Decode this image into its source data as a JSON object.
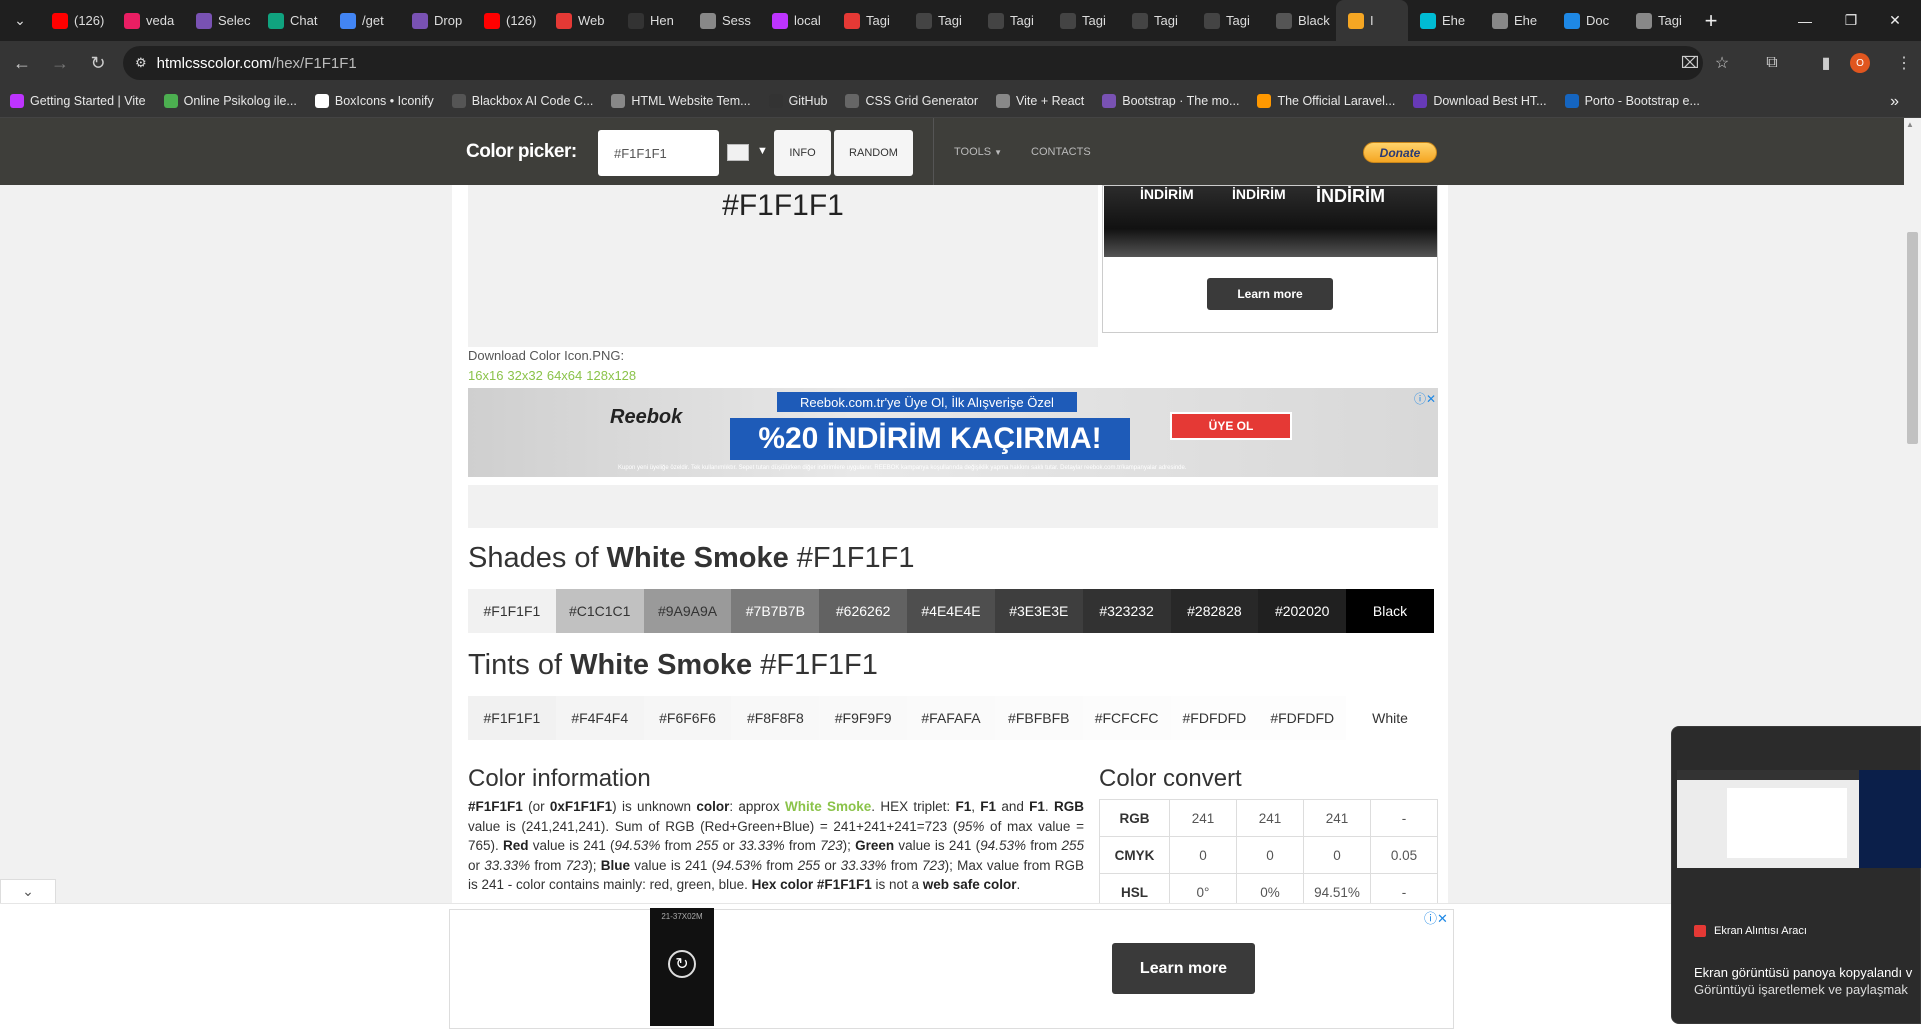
{
  "browser": {
    "tabs": [
      {
        "label": "(126)",
        "icon": "youtube-icon",
        "color": "#ff0000"
      },
      {
        "label": "veda",
        "icon": "bi-icon",
        "color": "#e91e63"
      },
      {
        "label": "Selec",
        "icon": "bootstrap-icon",
        "color": "#7952b3"
      },
      {
        "label": "Chat",
        "icon": "chatgpt-icon",
        "color": "#10a37f"
      },
      {
        "label": "/get",
        "icon": "google-icon",
        "color": "#4285f4"
      },
      {
        "label": "Drop",
        "icon": "bootstrap-icon",
        "color": "#7952b3"
      },
      {
        "label": "(126)",
        "icon": "youtube-icon",
        "color": "#ff0000"
      },
      {
        "label": "Web",
        "icon": "opera-icon",
        "color": "#e53935"
      },
      {
        "label": "Hen",
        "icon": "github-icon",
        "color": "#333333"
      },
      {
        "label": "Sess",
        "icon": "globe-icon",
        "color": "#888888"
      },
      {
        "label": "local",
        "icon": "vite-icon",
        "color": "#bd34fe"
      },
      {
        "label": "Tagi",
        "icon": "pencil-icon",
        "color": "#e53935"
      },
      {
        "label": "Tagi",
        "icon": "codepen-icon",
        "color": "#444444"
      },
      {
        "label": "Tagi",
        "icon": "codepen-icon",
        "color": "#444444"
      },
      {
        "label": "Tagi",
        "icon": "codepen-icon",
        "color": "#444444"
      },
      {
        "label": "Tagi",
        "icon": "codepen-icon",
        "color": "#444444"
      },
      {
        "label": "Tagi",
        "icon": "codepen-icon",
        "color": "#444444"
      },
      {
        "label": "Black",
        "icon": "blackbox-icon",
        "color": "#555555"
      },
      {
        "label": "I",
        "icon": "colorwheel-icon",
        "color": "#f5a623",
        "active": true
      },
      {
        "label": "Ehe",
        "icon": "e-icon",
        "color": "#00bcd4"
      },
      {
        "label": "Ehe",
        "icon": "globe-icon",
        "color": "#888888"
      },
      {
        "label": "Doc",
        "icon": "d-icon",
        "color": "#1e88e5"
      },
      {
        "label": "Tagi",
        "icon": "globe-icon",
        "color": "#888888"
      }
    ],
    "url_host": "htmlcsscolor.com",
    "url_path": "/hex/F1F1F1",
    "profile_initial": "O",
    "bookmarks": [
      {
        "label": "Getting Started | Vite",
        "icon": "vite-icon",
        "color": "#bd34fe"
      },
      {
        "label": "Online Psikolog ile...",
        "icon": "leaf-icon",
        "color": "#4caf50"
      },
      {
        "label": "BoxIcons • Iconify",
        "icon": "iconify-icon",
        "color": "#ffffff"
      },
      {
        "label": "Blackbox AI Code C...",
        "icon": "blackbox-icon",
        "color": "#555555"
      },
      {
        "label": "HTML Website Tem...",
        "icon": "globe-icon",
        "color": "#888888"
      },
      {
        "label": "GitHub",
        "icon": "github-icon",
        "color": "#333333"
      },
      {
        "label": "CSS Grid Generator",
        "icon": "grid-icon",
        "color": "#666666"
      },
      {
        "label": "Vite + React",
        "icon": "globe-icon",
        "color": "#888888"
      },
      {
        "label": "Bootstrap · The mo...",
        "icon": "bootstrap-icon",
        "color": "#7952b3"
      },
      {
        "label": "The Official Laravel...",
        "icon": "rocket-icon",
        "color": "#ff9800"
      },
      {
        "label": "Download Best HT...",
        "icon": "hash-icon",
        "color": "#673ab7"
      },
      {
        "label": "Porto - Bootstrap e...",
        "icon": "flag-icon",
        "color": "#1565c0"
      }
    ]
  },
  "header": {
    "picker_label": "Color picker:",
    "picker_value": "#F1F1F1",
    "info_label": "INFO",
    "random_label": "RANDOM",
    "tools_label": "TOOLS",
    "contacts_label": "CONTACTS",
    "donate_label": "Donate"
  },
  "preview": {
    "hex": "#F1F1F1",
    "download_label": "Download Color Icon.PNG:",
    "sizes": [
      "16x16",
      "32x32",
      "64x64",
      "128x128"
    ]
  },
  "ads": {
    "top_headlines": [
      "İNDİRİM",
      "İNDİRİM",
      "İNDİRİM"
    ],
    "top_button": "Learn more",
    "reebok_logo": "Reebok",
    "reebok_top": "Reebok.com.tr'ye Üye Ol, İlk Alışverişe Özel",
    "reebok_main": "%20 İNDİRİM KAÇIRMA!",
    "reebok_cta": "ÜYE OL",
    "reebok_fine": "Kupon yeni üyeliğe özeldir. Tek kullanımlıktır. Sepet tutarı düşülürken diğer indirimlere uygulanır. REEBOK kampanya koşullarında değişiklik yapma hakkını saklı tutar. Detaylar reebok.com.tr/kampanyalar adresinde.",
    "bottom_button": "Learn more",
    "bottom_thumb_text": "21-37X02M"
  },
  "shades": {
    "title_prefix": "Shades of ",
    "title_name": "White Smoke",
    "title_suffix": " #F1F1F1",
    "items": [
      {
        "label": "#F1F1F1",
        "bg": "#F1F1F1",
        "fg": "#333333"
      },
      {
        "label": "#C1C1C1",
        "bg": "#C1C1C1",
        "fg": "#333333"
      },
      {
        "label": "#9A9A9A",
        "bg": "#9A9A9A",
        "fg": "#333333"
      },
      {
        "label": "#7B7B7B",
        "bg": "#7B7B7B",
        "fg": "#ffffff"
      },
      {
        "label": "#626262",
        "bg": "#626262",
        "fg": "#ffffff"
      },
      {
        "label": "#4E4E4E",
        "bg": "#4E4E4E",
        "fg": "#ffffff"
      },
      {
        "label": "#3E3E3E",
        "bg": "#3E3E3E",
        "fg": "#ffffff"
      },
      {
        "label": "#323232",
        "bg": "#323232",
        "fg": "#ffffff"
      },
      {
        "label": "#282828",
        "bg": "#282828",
        "fg": "#ffffff"
      },
      {
        "label": "#202020",
        "bg": "#202020",
        "fg": "#ffffff"
      },
      {
        "label": "Black",
        "bg": "#000000",
        "fg": "#ffffff"
      }
    ]
  },
  "tints": {
    "title_prefix": "Tints of ",
    "title_name": "White Smoke",
    "title_suffix": " #F1F1F1",
    "items": [
      {
        "label": "#F1F1F1",
        "bg": "#F1F1F1",
        "fg": "#333333"
      },
      {
        "label": "#F4F4F4",
        "bg": "#F4F4F4",
        "fg": "#333333"
      },
      {
        "label": "#F6F6F6",
        "bg": "#F6F6F6",
        "fg": "#333333"
      },
      {
        "label": "#F8F8F8",
        "bg": "#F8F8F8",
        "fg": "#333333"
      },
      {
        "label": "#F9F9F9",
        "bg": "#F9F9F9",
        "fg": "#333333"
      },
      {
        "label": "#FAFAFA",
        "bg": "#FAFAFA",
        "fg": "#333333"
      },
      {
        "label": "#FBFBFB",
        "bg": "#FBFBFB",
        "fg": "#333333"
      },
      {
        "label": "#FCFCFC",
        "bg": "#FCFCFC",
        "fg": "#333333"
      },
      {
        "label": "#FDFDFD",
        "bg": "#FDFDFD",
        "fg": "#333333"
      },
      {
        "label": "#FDFDFD",
        "bg": "#FDFDFD",
        "fg": "#333333"
      },
      {
        "label": "White",
        "bg": "#FFFFFF",
        "fg": "#333333"
      }
    ]
  },
  "info": {
    "title": "Color information",
    "paragraph": [
      [
        "b",
        "#F1F1F1"
      ],
      [
        "t",
        " (or "
      ],
      [
        "b",
        "0xF1F1F1"
      ],
      [
        "t",
        ") is unknown "
      ],
      [
        "b",
        "color"
      ],
      [
        "t",
        ": approx "
      ],
      [
        "g",
        "White Smoke"
      ],
      [
        "t",
        ". HEX triplet: "
      ],
      [
        "b",
        "F1"
      ],
      [
        "t",
        ", "
      ],
      [
        "b",
        "F1"
      ],
      [
        "t",
        " and "
      ],
      [
        "b",
        "F1"
      ],
      [
        "t",
        ". "
      ],
      [
        "b",
        "RGB"
      ],
      [
        "t",
        " value is (241,241,241). Sum of RGB (Red+Green+Blue) = 241+241+241=723 ("
      ],
      [
        "i",
        "95%"
      ],
      [
        "t",
        " of max value = 765). "
      ],
      [
        "b",
        "Red"
      ],
      [
        "t",
        " value is 241 ("
      ],
      [
        "i",
        "94.53%"
      ],
      [
        "t",
        " from "
      ],
      [
        "i",
        "255"
      ],
      [
        "t",
        " or "
      ],
      [
        "i",
        "33.33%"
      ],
      [
        "t",
        " from "
      ],
      [
        "i",
        "723"
      ],
      [
        "t",
        "); "
      ],
      [
        "b",
        "Green"
      ],
      [
        "t",
        " value is 241 ("
      ],
      [
        "i",
        "94.53%"
      ],
      [
        "t",
        " from "
      ],
      [
        "i",
        "255"
      ],
      [
        "t",
        " or "
      ],
      [
        "i",
        "33.33%"
      ],
      [
        "t",
        " from "
      ],
      [
        "i",
        "723"
      ],
      [
        "t",
        "); "
      ],
      [
        "b",
        "Blue"
      ],
      [
        "t",
        " value is 241 ("
      ],
      [
        "i",
        "94.53%"
      ],
      [
        "t",
        " from "
      ],
      [
        "i",
        "255"
      ],
      [
        "t",
        " or "
      ],
      [
        "i",
        "33.33%"
      ],
      [
        "t",
        " from "
      ],
      [
        "i",
        "723"
      ],
      [
        "t",
        "); Max value from RGB is 241 - color contains mainly: red, green, blue. "
      ],
      [
        "b",
        "Hex color #F1F1F1"
      ],
      [
        "t",
        " is not a "
      ],
      [
        "b",
        "web safe color"
      ],
      [
        "t",
        "."
      ]
    ]
  },
  "convert": {
    "title": "Color convert",
    "rows": [
      {
        "label": "RGB",
        "values": [
          "241",
          "241",
          "241",
          "-"
        ]
      },
      {
        "label": "CMYK",
        "values": [
          "0",
          "0",
          "0",
          "0.05"
        ]
      },
      {
        "label": "HSL",
        "values": [
          "0°",
          "0%",
          "94.51%",
          "-"
        ]
      }
    ]
  },
  "notification": {
    "app": "Ekran Alıntısı Aracı",
    "line1": "Ekran görüntüsü panoya kopyalandı v",
    "line2": "Görüntüyü işaretlemek ve paylaşmak"
  }
}
